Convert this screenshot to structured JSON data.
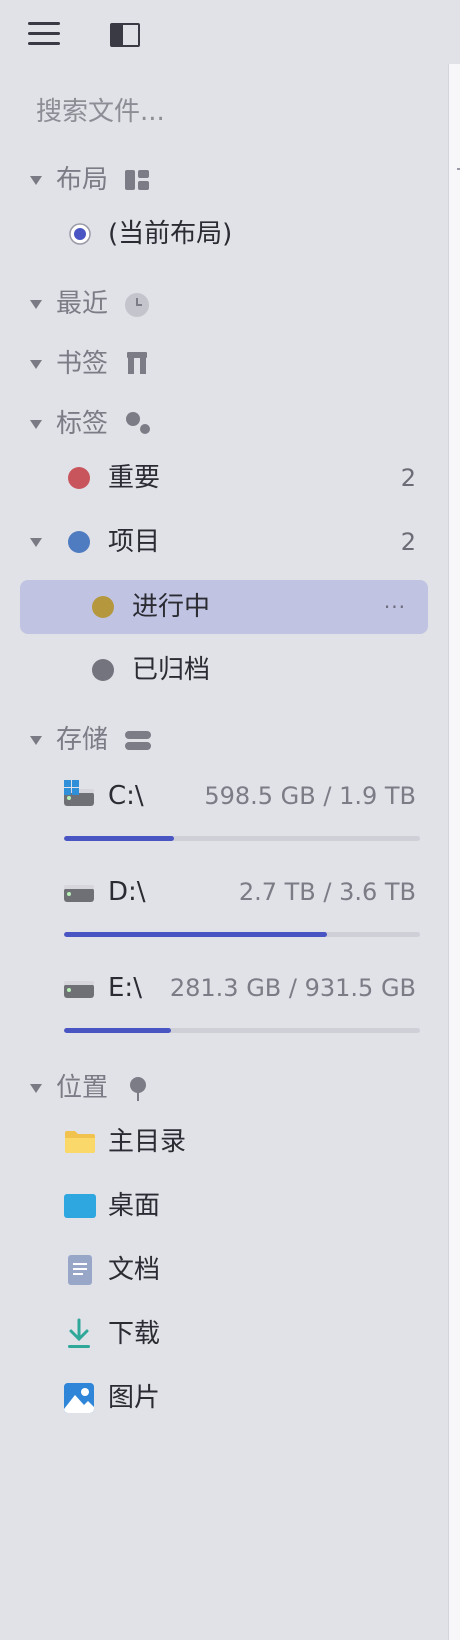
{
  "toolbar": {
    "menu_icon": "menu-icon",
    "panel_icon": "sidebar-toggle-icon"
  },
  "search": {
    "placeholder": "搜索文件..."
  },
  "sections": {
    "layout": {
      "label": "布局",
      "icon": "layout-grid-icon",
      "items": [
        {
          "label": "(当前布局)"
        }
      ]
    },
    "recent": {
      "label": "最近",
      "icon": "clock-icon"
    },
    "bookmarks": {
      "label": "书签",
      "icon": "bookmark-icon"
    },
    "tags": {
      "label": "标签",
      "icon": "tags-icon",
      "items": [
        {
          "label": "重要",
          "count": "2",
          "color": "#c9555c"
        },
        {
          "label": "项目",
          "count": "2",
          "color": "#4f7cc0"
        },
        {
          "label": "进行中",
          "color": "#b5983e",
          "more": "···"
        },
        {
          "label": "已归档",
          "color": "#74747f"
        }
      ]
    },
    "storage": {
      "label": "存储",
      "icon": "storage-icon",
      "drives": [
        {
          "name": "C:\\",
          "size": "598.5 GB / 1.9 TB",
          "used_fraction": 0.31
        },
        {
          "name": "D:\\",
          "size": "2.7 TB / 3.6 TB",
          "used_fraction": 0.74
        },
        {
          "name": "E:\\",
          "size": "281.3 GB / 931.5 GB",
          "used_fraction": 0.3
        }
      ]
    },
    "locations": {
      "label": "位置",
      "icon": "pin-icon",
      "items": [
        {
          "label": "主目录",
          "icon": "folder-icon"
        },
        {
          "label": "桌面",
          "icon": "desktop-icon"
        },
        {
          "label": "文档",
          "icon": "document-icon"
        },
        {
          "label": "下载",
          "icon": "download-icon"
        },
        {
          "label": "图片",
          "icon": "pictures-icon"
        }
      ]
    }
  },
  "colors": {
    "accent": "#4a55c4",
    "selected_bg": "#c0c4e2",
    "background": "#e1e1e8"
  }
}
